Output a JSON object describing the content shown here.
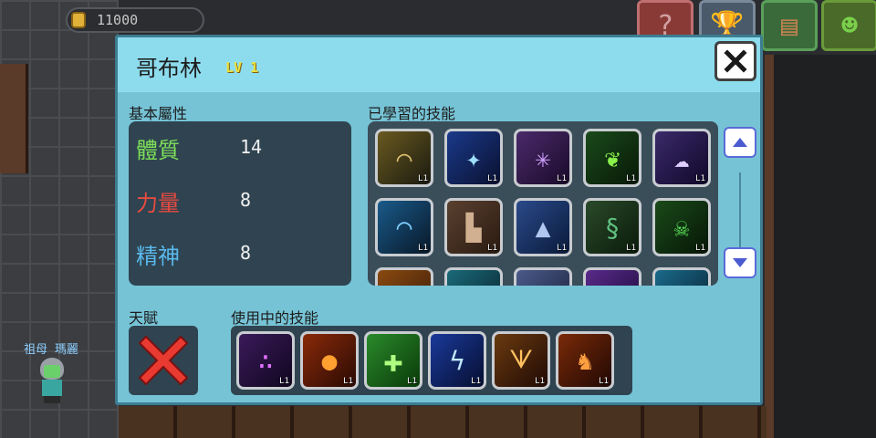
{
  "hud": {
    "coins": "11000"
  },
  "npc": {
    "name": "祖母 瑪麗"
  },
  "panel": {
    "title": "哥布林",
    "level": "LV 1",
    "base_attributes_label": "基本屬性",
    "learned_skills_label": "已學習的技能",
    "talent_label": "天賦",
    "active_skills_label": "使用中的技能",
    "attributes": [
      {
        "name": "體質",
        "value": "14",
        "color": "#7ee05a"
      },
      {
        "name": "力量",
        "value": "8",
        "color": "#e84a40"
      },
      {
        "name": "精神",
        "value": "8",
        "color": "#5ab8ec"
      }
    ],
    "learned_skills": [
      {
        "icon": "bow-icon",
        "level": "L1"
      },
      {
        "icon": "comet-icon",
        "level": "L1"
      },
      {
        "icon": "web-icon",
        "level": "L1"
      },
      {
        "icon": "leaf-icon",
        "level": "L1"
      },
      {
        "icon": "spirit-icon",
        "level": "L1"
      },
      {
        "icon": "wave-icon",
        "level": "L1"
      },
      {
        "icon": "boots-icon",
        "level": "L1"
      },
      {
        "icon": "wolf-icon",
        "level": "L1"
      },
      {
        "icon": "vine-icon",
        "level": "L1"
      },
      {
        "icon": "poison-skull-icon",
        "level": "L1"
      },
      {
        "icon": "fire-claw-icon",
        "level": ""
      },
      {
        "icon": "ice-slash-icon",
        "level": ""
      },
      {
        "icon": "wind-icon",
        "level": ""
      },
      {
        "icon": "arcane-slash-icon",
        "level": ""
      },
      {
        "icon": "frost-icon",
        "level": ""
      }
    ],
    "active_skills": [
      {
        "icon": "purple-orbs-icon",
        "level": "L1"
      },
      {
        "icon": "fireball-icon",
        "level": "L1"
      },
      {
        "icon": "heal-cross-icon",
        "level": "L1"
      },
      {
        "icon": "lightning-icon",
        "level": "L1"
      },
      {
        "icon": "fire-spikes-icon",
        "level": "L1"
      },
      {
        "icon": "fire-beast-icon",
        "level": "L1"
      }
    ]
  }
}
